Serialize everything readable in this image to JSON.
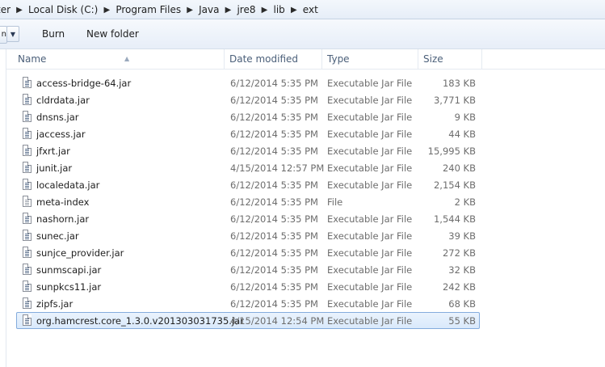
{
  "breadcrumb": {
    "items": [
      "ter",
      "Local Disk (C:)",
      "Program Files",
      "Java",
      "jre8",
      "lib",
      "ext"
    ]
  },
  "toolbar": {
    "organize_label": "n",
    "burn_label": "Burn",
    "new_folder_label": "New folder"
  },
  "columns": {
    "name": "Name",
    "date_modified": "Date modified",
    "type": "Type",
    "size": "Size"
  },
  "files": [
    {
      "name": "access-bridge-64.jar",
      "date": "6/12/2014 5:35 PM",
      "type": "Executable Jar File",
      "size": "183 KB",
      "icon": "jar-file-icon"
    },
    {
      "name": "cldrdata.jar",
      "date": "6/12/2014 5:35 PM",
      "type": "Executable Jar File",
      "size": "3,771 KB",
      "icon": "jar-file-icon"
    },
    {
      "name": "dnsns.jar",
      "date": "6/12/2014 5:35 PM",
      "type": "Executable Jar File",
      "size": "9 KB",
      "icon": "jar-file-icon"
    },
    {
      "name": "jaccess.jar",
      "date": "6/12/2014 5:35 PM",
      "type": "Executable Jar File",
      "size": "44 KB",
      "icon": "jar-file-icon"
    },
    {
      "name": "jfxrt.jar",
      "date": "6/12/2014 5:35 PM",
      "type": "Executable Jar File",
      "size": "15,995 KB",
      "icon": "jar-file-icon"
    },
    {
      "name": "junit.jar",
      "date": "4/15/2014 12:57 PM",
      "type": "Executable Jar File",
      "size": "240 KB",
      "icon": "jar-file-icon"
    },
    {
      "name": "localedata.jar",
      "date": "6/12/2014 5:35 PM",
      "type": "Executable Jar File",
      "size": "2,154 KB",
      "icon": "jar-file-icon"
    },
    {
      "name": "meta-index",
      "date": "6/12/2014 5:35 PM",
      "type": "File",
      "size": "2 KB",
      "icon": "file-icon"
    },
    {
      "name": "nashorn.jar",
      "date": "6/12/2014 5:35 PM",
      "type": "Executable Jar File",
      "size": "1,544 KB",
      "icon": "jar-file-icon"
    },
    {
      "name": "sunec.jar",
      "date": "6/12/2014 5:35 PM",
      "type": "Executable Jar File",
      "size": "39 KB",
      "icon": "jar-file-icon"
    },
    {
      "name": "sunjce_provider.jar",
      "date": "6/12/2014 5:35 PM",
      "type": "Executable Jar File",
      "size": "272 KB",
      "icon": "jar-file-icon"
    },
    {
      "name": "sunmscapi.jar",
      "date": "6/12/2014 5:35 PM",
      "type": "Executable Jar File",
      "size": "32 KB",
      "icon": "jar-file-icon"
    },
    {
      "name": "sunpkcs11.jar",
      "date": "6/12/2014 5:35 PM",
      "type": "Executable Jar File",
      "size": "242 KB",
      "icon": "jar-file-icon"
    },
    {
      "name": "zipfs.jar",
      "date": "6/12/2014 5:35 PM",
      "type": "Executable Jar File",
      "size": "68 KB",
      "icon": "jar-file-icon"
    },
    {
      "name": "org.hamcrest.core_1.3.0.v201303031735.jar",
      "date": "4/15/2014 12:54 PM",
      "type": "Executable Jar File",
      "size": "55 KB",
      "icon": "jar-file-icon",
      "selected": true
    }
  ],
  "colors": {
    "selection_border": "#84acdd",
    "selection_fill": "#d9e9fb",
    "header_text": "#4c607a"
  }
}
